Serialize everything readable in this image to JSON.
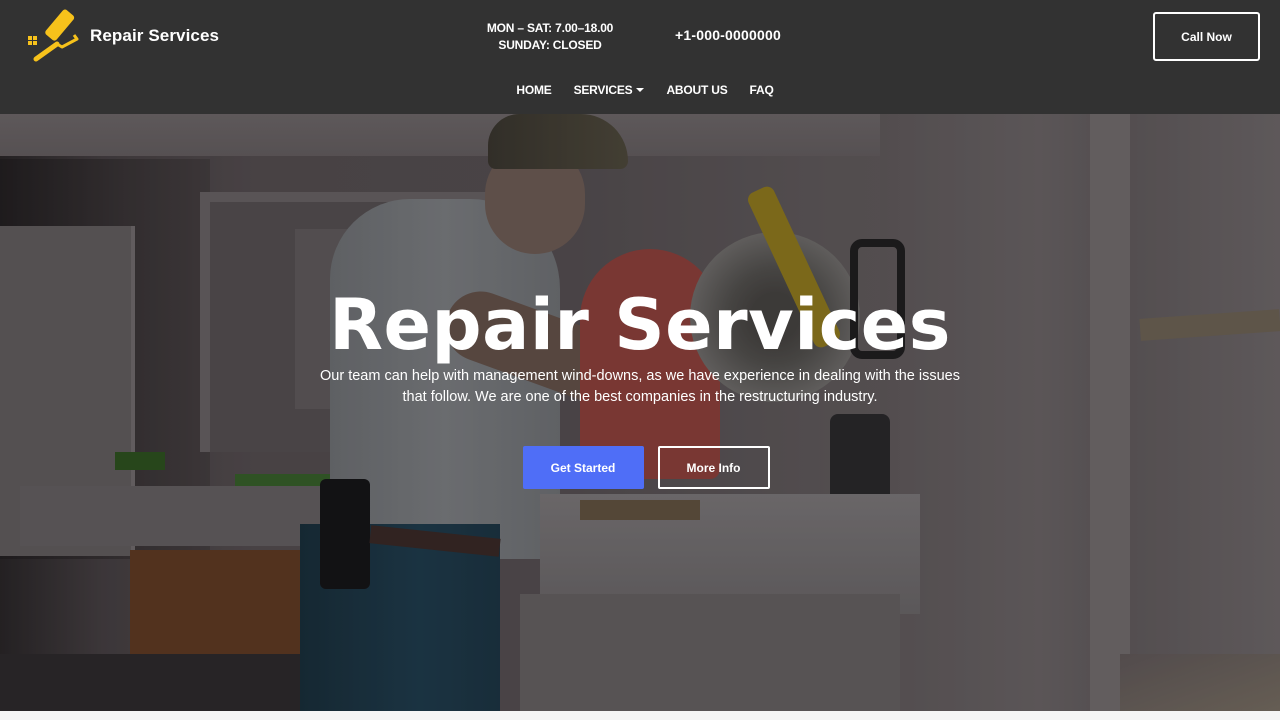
{
  "header": {
    "brand_name": "Repair Services",
    "brand_icon": "paint-roller-icon",
    "hours_line1": "MON – SAT: 7.00–18.00",
    "hours_line2": "SUNDAY: CLOSED",
    "phone": "+1-000-0000000",
    "call_button": "Call Now"
  },
  "nav": {
    "items": [
      {
        "label": "HOME",
        "has_dropdown": false
      },
      {
        "label": "SERVICES",
        "has_dropdown": true
      },
      {
        "label": "ABOUT US",
        "has_dropdown": false
      },
      {
        "label": "FAQ",
        "has_dropdown": false
      }
    ]
  },
  "hero": {
    "title": "Repair Services",
    "subtitle_line1": "Our team can help with management wind-downs, as we have experience in dealing with the issues",
    "subtitle_line2": "that follow. We are one of the best companies in the restructuring industry.",
    "primary_button": "Get Started",
    "secondary_button": "More Info",
    "background_image": "worker using miter saw in room under renovation"
  },
  "colors": {
    "header_bg": "#323232",
    "accent_yellow": "#f7c21b",
    "primary_button": "#4f6ef7",
    "text_light": "#ffffff",
    "page_bg": "#f5f5f5"
  }
}
